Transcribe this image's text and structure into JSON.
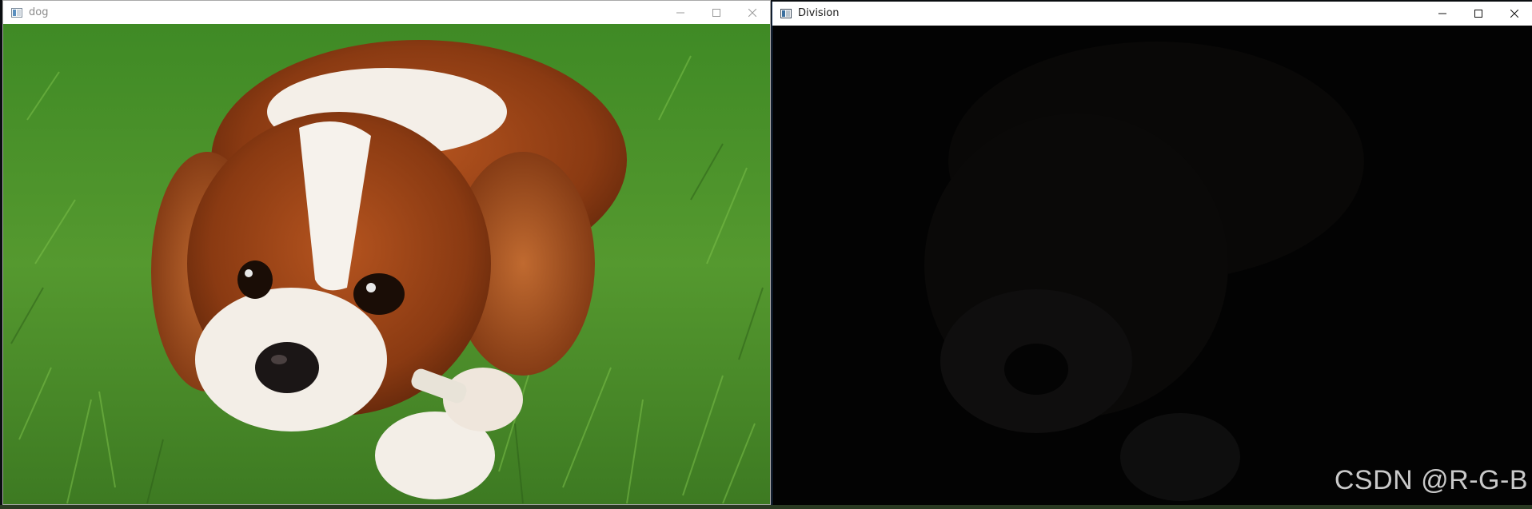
{
  "windows": {
    "dog": {
      "title": "dog",
      "image_icon": "image-window-icon",
      "controls": [
        "minimize-icon",
        "maximize-icon",
        "close-icon"
      ]
    },
    "division": {
      "title": "Division",
      "image_icon": "image-window-icon",
      "controls": [
        "minimize-icon",
        "maximize-icon",
        "close-icon"
      ],
      "watermark": "CSDN @R-G-B"
    }
  },
  "colors": {
    "grass_green": "#4f8f2c",
    "dog_fur_brown": "#8a3a12",
    "division_background": "#030303"
  }
}
